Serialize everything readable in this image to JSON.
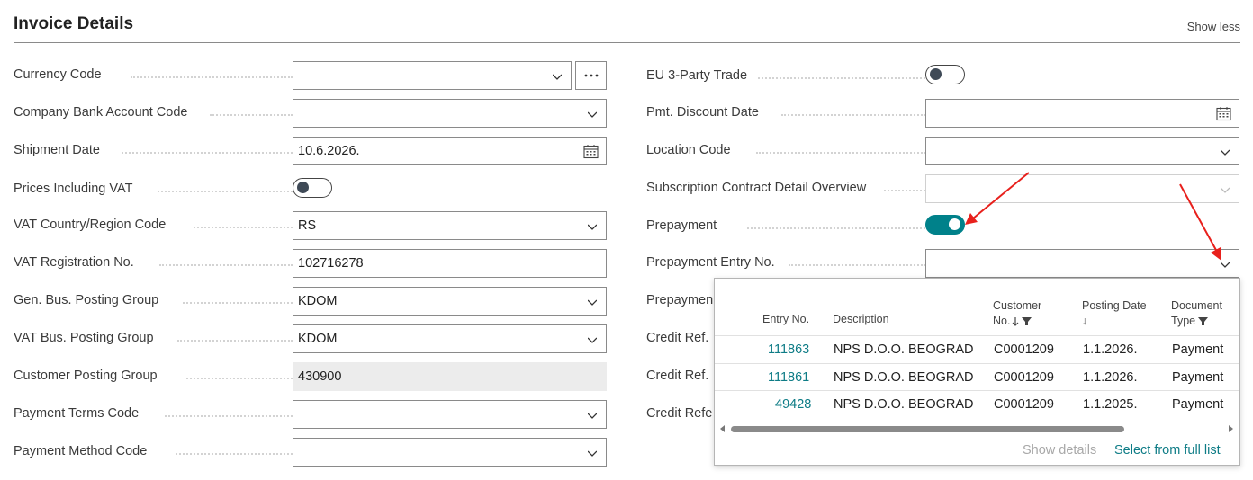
{
  "section": {
    "title": "Invoice Details",
    "show_less": "Show less"
  },
  "left_fields": [
    {
      "label": "Currency Code",
      "value": ""
    },
    {
      "label": "Company Bank Account Code",
      "value": ""
    },
    {
      "label": "Shipment Date",
      "value": "10.6.2026."
    },
    {
      "label": "Prices Including VAT",
      "value": "off"
    },
    {
      "label": "VAT Country/Region Code",
      "value": "RS"
    },
    {
      "label": "VAT Registration No.",
      "value": "102716278"
    },
    {
      "label": "Gen. Bus. Posting Group",
      "value": "KDOM"
    },
    {
      "label": "VAT Bus. Posting Group",
      "value": "KDOM"
    },
    {
      "label": "Customer Posting Group",
      "value": "430900"
    },
    {
      "label": "Payment Terms Code",
      "value": ""
    },
    {
      "label": "Payment Method Code",
      "value": ""
    }
  ],
  "right_fields": [
    {
      "label": "EU 3-Party Trade",
      "value": "off"
    },
    {
      "label": "Pmt. Discount Date",
      "value": ""
    },
    {
      "label": "Location Code",
      "value": ""
    },
    {
      "label": "Subscription Contract Detail Overview",
      "value": ""
    },
    {
      "label": "Prepayment",
      "value": "on"
    },
    {
      "label": "Prepayment Entry No.",
      "value": ""
    },
    {
      "label": "Prepaymen"
    },
    {
      "label": "Credit Ref."
    },
    {
      "label": "Credit Ref."
    },
    {
      "label": "Credit Refe"
    }
  ],
  "lookup": {
    "headers": {
      "entry_no": "Entry No.",
      "description": "Description",
      "customer_no_1": "Customer",
      "customer_no_2": "No.",
      "posting_date_1": "Posting Date",
      "posting_date_2": "↓",
      "doc_type_1": "Document",
      "doc_type_2": "Type"
    },
    "rows": [
      {
        "entry_no": "111863",
        "description": "NPS D.O.O. BEOGRAD",
        "customer_no": "C0001209",
        "posting_date": "1.1.2026.",
        "doc_type": "Payment"
      },
      {
        "entry_no": "111861",
        "description": "NPS D.O.O. BEOGRAD",
        "customer_no": "C0001209",
        "posting_date": "1.1.2026.",
        "doc_type": "Payment"
      },
      {
        "entry_no": "49428",
        "description": "NPS D.O.O. BEOGRAD",
        "customer_no": "C0001209",
        "posting_date": "1.1.2025.",
        "doc_type": "Payment"
      }
    ],
    "show_details": "Show details",
    "select_full_list": "Select from full list"
  },
  "colors": {
    "accent": "#00818a",
    "link": "#0e7c86",
    "annotation_arrow": "#e8201c"
  }
}
